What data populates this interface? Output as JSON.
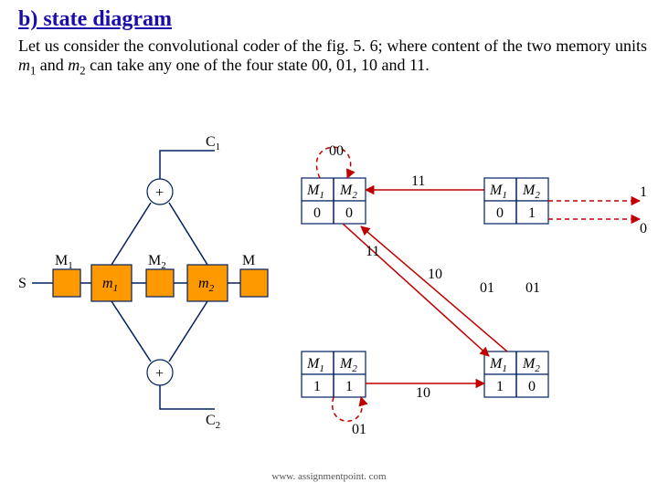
{
  "heading": "b) state diagram",
  "paragraph_a": "Let us consider the convolutional coder of the fig. 5. 6; where content of the two memory units ",
  "paragraph_m1": "m",
  "paragraph_m1s": "1",
  "paragraph_mid": " and ",
  "paragraph_m2": "m",
  "paragraph_m2s": "2",
  "paragraph_b": " can take any one of the four state 00, 01, 10 and 11.",
  "footer": "www. assignmentpoint. com",
  "encoder": {
    "S": "S",
    "M1": "M",
    "M1s": "1",
    "m1": "m",
    "m1s": "1",
    "M2": "M",
    "M2s": "2",
    "m2": "m",
    "m2s": "2",
    "Mk": "M",
    "Mks": "",
    "plus": "+",
    "C1": "C",
    "C1s": "1",
    "C2": "C",
    "C2s": "2"
  },
  "states": {
    "headM1": "M",
    "headM1s": "1",
    "headM2": "M",
    "headM2s": "2",
    "s00a": "0",
    "s00b": "0",
    "s01a": "0",
    "s01b": "1",
    "s11a": "1",
    "s11b": "1",
    "s10a": "1",
    "s10b": "0",
    "t00": "00",
    "t11a": "11",
    "t11b": "11",
    "t10a": "10",
    "t01a": "01",
    "t01b": "01",
    "t10b": "10",
    "t01c": "01",
    "o1": "1",
    "o0": "0"
  }
}
